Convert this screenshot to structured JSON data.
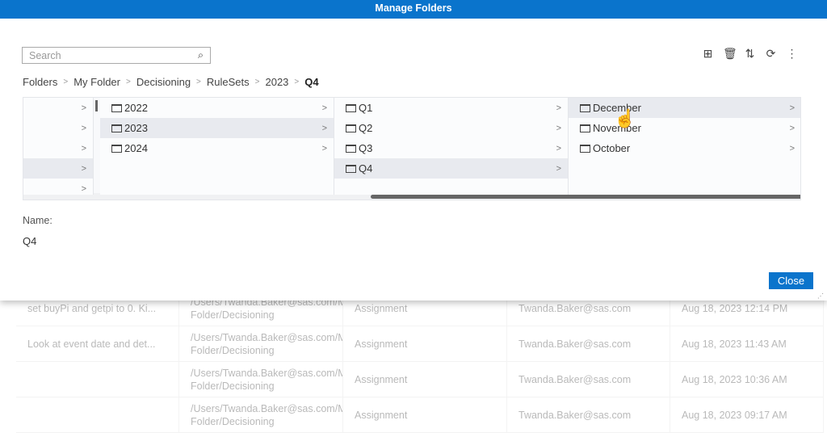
{
  "dialog": {
    "title": "Manage Folders",
    "search_placeholder": "Search",
    "close_label": "Close",
    "name_label": "Name:",
    "name_value": "Q4"
  },
  "toolbar": [
    {
      "icon": "new-folder-icon",
      "glyph": "⊞"
    },
    {
      "icon": "delete-icon",
      "glyph": "🗑"
    },
    {
      "icon": "sort-icon",
      "glyph": "⇅"
    },
    {
      "icon": "refresh-icon",
      "glyph": "⟳"
    },
    {
      "icon": "more-icon",
      "glyph": "⋮"
    }
  ],
  "breadcrumb": [
    "Folders",
    "My Folder",
    "Decisioning",
    "RuleSets",
    "2023",
    "Q4"
  ],
  "columns": [
    {
      "items": [
        "",
        "",
        "",
        "",
        ""
      ],
      "selected": 3
    },
    {
      "items": [
        "2022",
        "2023",
        "2024"
      ],
      "selected": 1
    },
    {
      "items": [
        "Q1",
        "Q2",
        "Q3",
        "Q4"
      ],
      "selected": 3
    },
    {
      "items": [
        "December",
        "November",
        "October"
      ],
      "selected": 0
    }
  ],
  "background_rows": [
    {
      "desc": "set buyPi and getpi to 0. Ki...",
      "path": "/Users/Twanda.Baker@sas.com/My Folder/Decisioning",
      "type": "Assignment",
      "user": "Twanda.Baker@sas.com",
      "date": "Aug 18, 2023 12:14 PM"
    },
    {
      "desc": "Look at event date and det...",
      "path": "/Users/Twanda.Baker@sas.com/My Folder/Decisioning",
      "type": "Assignment",
      "user": "Twanda.Baker@sas.com",
      "date": "Aug 18, 2023 11:43 AM"
    },
    {
      "desc": "",
      "path": "/Users/Twanda.Baker@sas.com/My Folder/Decisioning",
      "type": "Assignment",
      "user": "Twanda.Baker@sas.com",
      "date": "Aug 18, 2023 10:36 AM"
    },
    {
      "desc": "",
      "path": "/Users/Twanda.Baker@sas.com/My Folder/Decisioning",
      "type": "Assignment",
      "user": "Twanda.Baker@sas.com",
      "date": "Aug 18, 2023 09:17 AM"
    }
  ]
}
